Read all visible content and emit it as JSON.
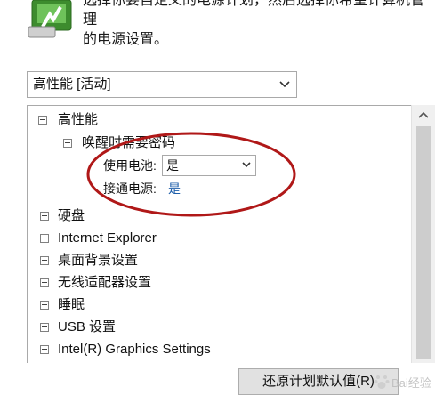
{
  "header": {
    "text_line1": "选择你要自定义的电源计划，然后选择你希望计算机管理",
    "text_line2": "的电源设置。",
    "icon": "power-plan-battery-icon"
  },
  "plan_select": {
    "value": "高性能 [活动]",
    "icon": "chevron-down-icon"
  },
  "tree": {
    "root": "高性能",
    "child": "唤醒时需要密码",
    "on_battery_label": "使用电池:",
    "on_battery_value": "是",
    "plugged_in_label": "接通电源:",
    "plugged_in_value": "是",
    "items": [
      "硬盘",
      "Internet Explorer",
      "桌面背景设置",
      "无线适配器设置",
      "睡眠",
      "USB 设置",
      "Intel(R) Graphics Settings"
    ]
  },
  "buttons": {
    "restore_defaults": "还原计划默认值(R)"
  },
  "watermark": {
    "text": "Bai经验",
    "icon": "baidu-paw-icon"
  },
  "colors": {
    "link": "#1f5faa",
    "highlight_ellipse": "#b01818"
  }
}
